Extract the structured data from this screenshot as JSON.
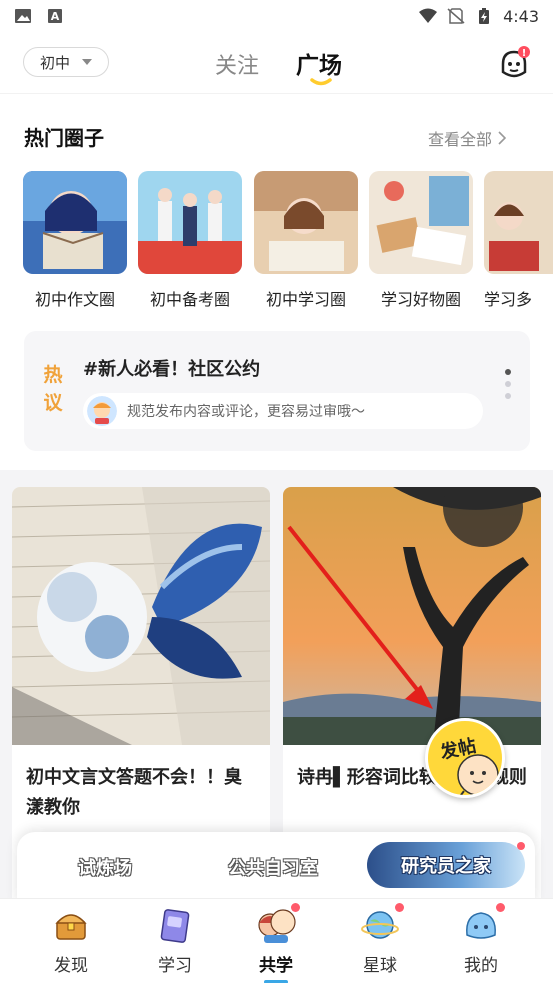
{
  "status_bar": {
    "time": "4:43"
  },
  "header": {
    "grade_select": "初中",
    "tabs": {
      "follow": "关注",
      "square": "广场"
    },
    "notification_badge": "!"
  },
  "hot_circles": {
    "title": "热门圈子",
    "view_all": "查看全部",
    "items": [
      {
        "label": "初中作文圈"
      },
      {
        "label": "初中备考圈"
      },
      {
        "label": "初中学习圈"
      },
      {
        "label": "学习好物圈"
      },
      {
        "label": "学习多"
      }
    ]
  },
  "hot_topic": {
    "badge": "热议",
    "title": "#新人必看！社区公约",
    "subtitle": "规范发布内容或评论，更容易过审哦～",
    "pager": {
      "current": 1,
      "total": 3
    }
  },
  "feed": {
    "posts": [
      {
        "title": "初中文言文答题不会！！臭漾教你"
      },
      {
        "title": "诗冉▌形容词比较级变化规则"
      }
    ],
    "fab_label": "发帖"
  },
  "quick_panel": {
    "items": [
      "试炼场",
      "公共自习室",
      "研究员之家"
    ]
  },
  "bottom_nav": {
    "items": [
      {
        "label": "发现"
      },
      {
        "label": "学习"
      },
      {
        "label": "共学"
      },
      {
        "label": "星球"
      },
      {
        "label": "我的"
      }
    ],
    "active": "共学"
  },
  "colors": {
    "accent": "#3aa7e6",
    "hot_badge": "#f0a23a",
    "underline_yellow": "#ffcc2e",
    "red_dot": "#ff5b6b"
  }
}
